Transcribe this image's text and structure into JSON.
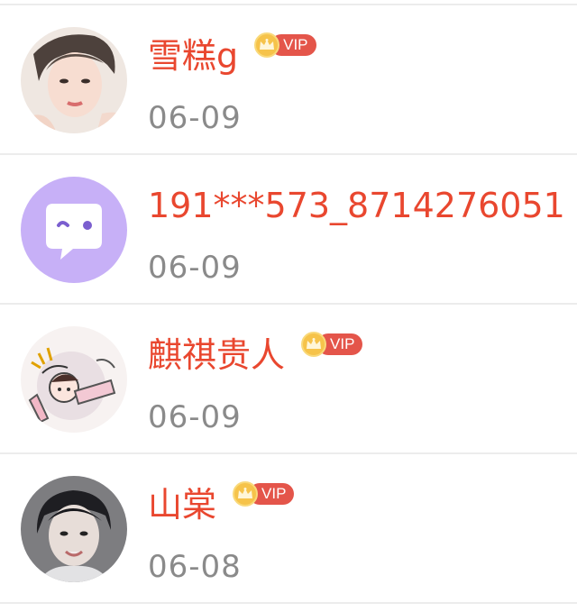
{
  "items": [
    {
      "name": "雪糕g",
      "vip": true,
      "vip_label": "VIP",
      "date": "06-09",
      "avatar": "avatar-photo-young-man"
    },
    {
      "name": "191***573_8714276051",
      "vip": false,
      "date": "06-09",
      "avatar": "default-chat-bubble-avatar"
    },
    {
      "name": "麒祺贵人",
      "vip": true,
      "vip_label": "VIP",
      "date": "06-09",
      "avatar": "anime-sketch-avatar"
    },
    {
      "name": "山棠",
      "vip": true,
      "vip_label": "VIP",
      "date": "06-08",
      "avatar": "avatar-photo-young-man"
    }
  ],
  "colors": {
    "name": "#e9472f",
    "date": "#8a8a8a",
    "vip_badge": "#e4554a",
    "vip_crown": "#f6c34a",
    "default_avatar_bg": "#c7b0f7",
    "divider": "#ececec"
  }
}
